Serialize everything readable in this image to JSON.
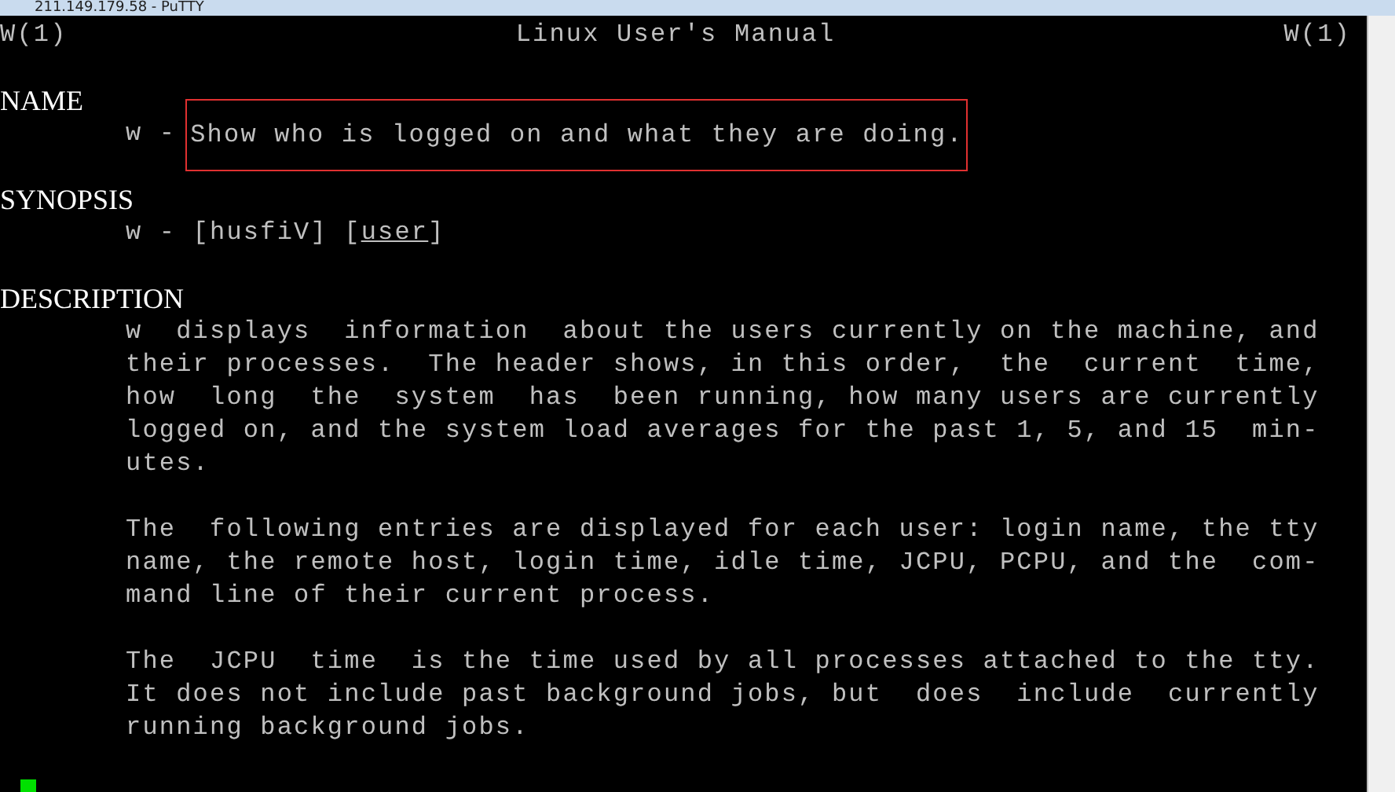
{
  "window": {
    "title": "211.149.179.58 - PuTTY"
  },
  "header": {
    "left": "W(1)",
    "center": "Linux User's Manual",
    "right": "W(1)"
  },
  "name_section": {
    "heading": "NAME",
    "command": "w -",
    "summary": "Show who is logged on and what they are doing.",
    "highlighted": true
  },
  "synopsis_section": {
    "heading": "SYNOPSIS",
    "parts": [
      {
        "text": "w - [husfiV] [",
        "underline": false
      },
      {
        "text": "user",
        "underline": true
      },
      {
        "text": "]",
        "underline": false
      }
    ]
  },
  "description_section": {
    "heading": "DESCRIPTION",
    "paragraphs": [
      {
        "lines": [
          "w  displays  information  about the users currently on the machine, and",
          "their processes.  The header shows, in this order,  the  current  time,",
          "how  long  the  system  has  been running, how many users are currently",
          "logged on, and the system load averages for the past 1, 5, and 15  min-",
          "utes."
        ]
      },
      {
        "lines": [
          "The  following entries are displayed for each user: login name, the tty",
          "name, the remote host, login time, idle time, JCPU, PCPU, and the  com-",
          "mand line of their current process."
        ]
      },
      {
        "lines": [
          "The  JCPU  time  is the time used by all processes attached to the tty.",
          "It does not include past background jobs, but  does  include  currently",
          "running background jobs."
        ]
      }
    ]
  },
  "cursor": {
    "visible": true
  }
}
